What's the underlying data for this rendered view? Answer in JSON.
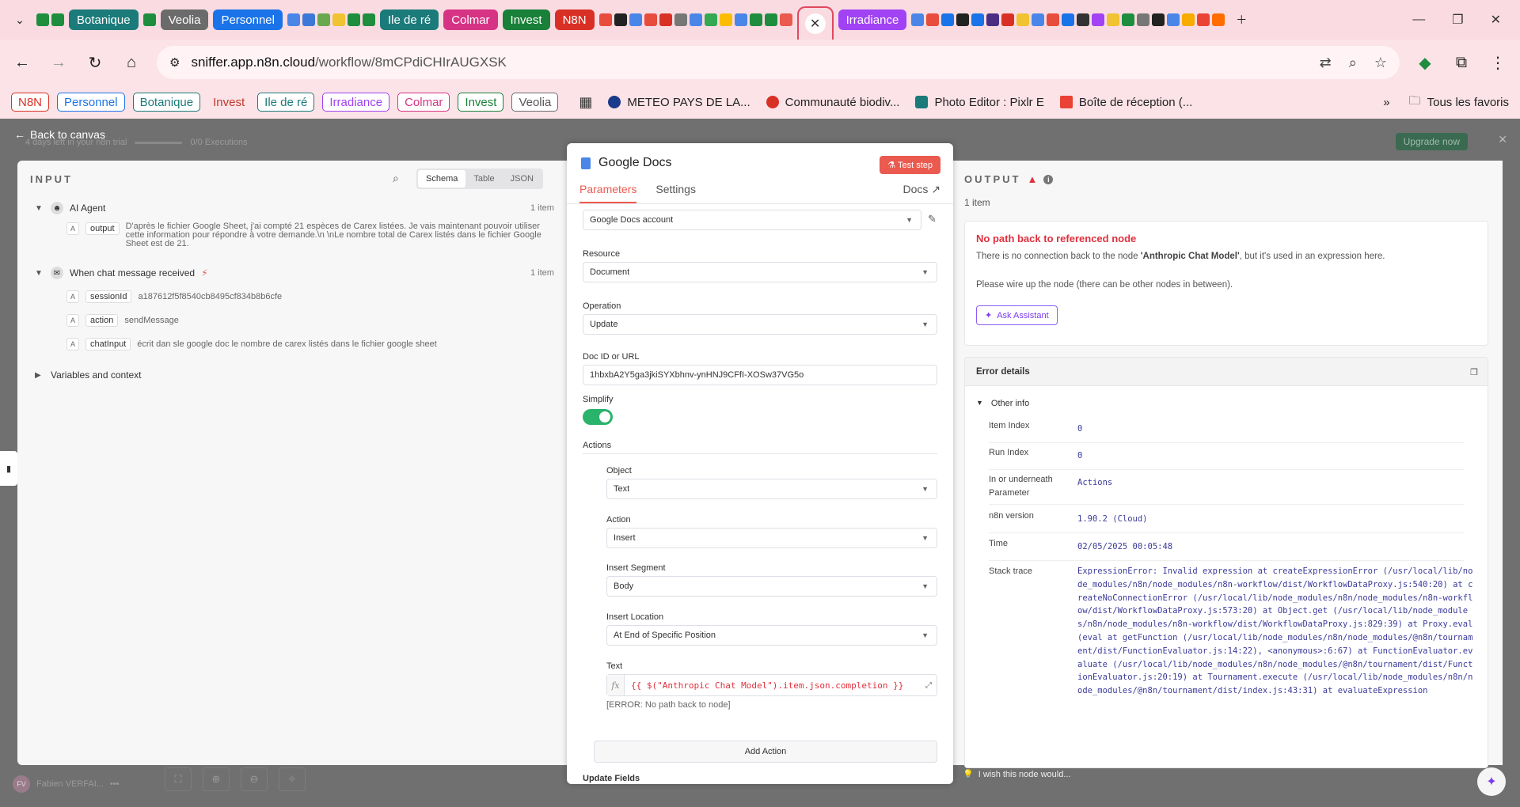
{
  "browser": {
    "tabs": [
      {
        "label": "Botanique",
        "color": "#1b7a7a"
      },
      {
        "label": "Veolia",
        "color": "#6b6b6b"
      },
      {
        "label": "Personnel",
        "color": "#1a73e8"
      },
      {
        "label": "Ile de ré",
        "color": "#1b7a7a"
      },
      {
        "label": "Colmar",
        "color": "#d63384"
      },
      {
        "label": "Invest",
        "color": "#188038"
      },
      {
        "label": "N8N",
        "color": "#d93025"
      },
      {
        "label": "Irradiance",
        "color": "#a142f4"
      }
    ],
    "url_host": "sniffer.app.n8n.cloud",
    "url_path": "/workflow/8mCPdiCHIrAUGXSK",
    "bookmarks": [
      {
        "label": "N8N",
        "color": "#d93025"
      },
      {
        "label": "Personnel",
        "color": "#1a73e8"
      },
      {
        "label": "Botanique",
        "color": "#1b7a7a"
      }
    ],
    "bookmark_plain": "Invest",
    "bookmarks2": [
      {
        "label": "Ile de ré",
        "color": "#1b7a7a"
      },
      {
        "label": "Irradiance",
        "color": "#a142f4"
      },
      {
        "label": "Colmar",
        "color": "#d63384"
      },
      {
        "label": "Invest",
        "color": "#188038"
      },
      {
        "label": "Veolia",
        "color": "#6b6b6b"
      }
    ],
    "bookmark_links": [
      "METEO PAYS DE LA...",
      "Communauté biodiv...",
      "Photo Editor : Pixlr E",
      "Boîte de réception (..."
    ],
    "all_bookmarks": "Tous les favoris"
  },
  "app": {
    "back_label": "Back to canvas",
    "trial_text": "4 days left in your n8n trial",
    "executions": "0/0 Executions",
    "upgrade": "Upgrade now",
    "user_name": "Fabien VERFAI...",
    "user_initials": "FV",
    "wish": "I wish this node would..."
  },
  "input": {
    "heading": "INPUT",
    "views": [
      "Schema",
      "Table",
      "JSON"
    ],
    "nodes": [
      {
        "name": "AI Agent",
        "count": "1 item",
        "fields": [
          {
            "key": "output",
            "value": "D'après le fichier Google Sheet, j'ai compté 21 espèces de Carex listées. Je vais maintenant pouvoir utiliser cette information pour répondre à votre demande.\\n \\nLe nombre total de Carex listés dans le fichier Google Sheet est de 21."
          }
        ]
      },
      {
        "name": "When chat message received",
        "count": "1 item",
        "fields": [
          {
            "key": "sessionId",
            "value": "a187612f5f8540cb8495cf834b8b6cfe"
          },
          {
            "key": "action",
            "value": "sendMessage"
          },
          {
            "key": "chatInput",
            "value": "écrit dan sle google doc le nombre de carex listés dans le fichier google sheet"
          }
        ]
      }
    ],
    "variables": "Variables and context"
  },
  "node": {
    "title": "Google Docs",
    "test_step": "Test step",
    "tabs": [
      "Parameters",
      "Settings"
    ],
    "docs": "Docs",
    "credential": "Google Docs account",
    "resource_label": "Resource",
    "resource": "Document",
    "operation_label": "Operation",
    "operation": "Update",
    "docid_label": "Doc ID or URL",
    "docid": "1hbxbA2Y5ga3jkiSYXbhnv-ynHNJ9CFfI-XOSw37VG5o",
    "simplify_label": "Simplify",
    "actions_label": "Actions",
    "object_label": "Object",
    "object": "Text",
    "action_label": "Action",
    "action": "Insert",
    "segment_label": "Insert Segment",
    "segment": "Body",
    "location_label": "Insert Location",
    "location": "At End of Specific Position",
    "text_label": "Text",
    "fx": "fx",
    "expression": "{{ $(\"Anthropic Chat Model\").item.json.completion }}",
    "expression_error": "[ERROR: No path back to node]",
    "add_action": "Add Action",
    "update_fields": "Update Fields"
  },
  "output": {
    "heading": "OUTPUT",
    "count": "1 item",
    "error_title": "No path back to referenced node",
    "error_msg_pre": "There is no connection back to the node ",
    "error_msg_node": "'Anthropic Chat Model'",
    "error_msg_post": ", but it's used in an expression here.",
    "error_hint": "Please wire up the node (there can be other nodes in between).",
    "ask_assistant": "Ask Assistant",
    "details_title": "Error details",
    "other_info": "Other info",
    "info": [
      {
        "key": "Item Index",
        "value": "0"
      },
      {
        "key": "Run Index",
        "value": "0"
      },
      {
        "key": "In or underneath Parameter",
        "value": "Actions"
      },
      {
        "key": "n8n version",
        "value": "1.90.2 (Cloud)"
      },
      {
        "key": "Time",
        "value": "02/05/2025 00:05:48"
      }
    ],
    "stack_label": "Stack trace",
    "stack": "ExpressionError: Invalid expression at createExpressionError (/usr/local/lib/node_modules/n8n/node_modules/n8n-workflow/dist/WorkflowDataProxy.js:540:20) at createNoConnectionError (/usr/local/lib/node_modules/n8n/node_modules/n8n-workflow/dist/WorkflowDataProxy.js:573:20) at Object.get (/usr/local/lib/node_modules/n8n/node_modules/n8n-workflow/dist/WorkflowDataProxy.js:829:39) at Proxy.eval (eval at getFunction (/usr/local/lib/node_modules/n8n/node_modules/@n8n/tournament/dist/FunctionEvaluator.js:14:22), <anonymous>:6:67) at FunctionEvaluator.evaluate (/usr/local/lib/node_modules/n8n/node_modules/@n8n/tournament/dist/FunctionEvaluator.js:20:19) at Tournament.execute (/usr/local/lib/node_modules/n8n/node_modules/@n8n/tournament/dist/index.js:43:31) at evaluateExpression"
  }
}
